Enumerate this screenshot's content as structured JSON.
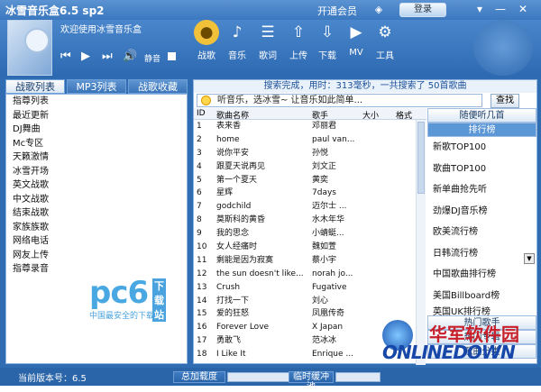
{
  "window": {
    "title": "冰雪音乐盒6.5 sp2",
    "vip": "开通会员",
    "login": "登录"
  },
  "player": {
    "now_playing": "欢迎使用冰雪音乐盒",
    "volume_label": "静音"
  },
  "toolbar": [
    {
      "label": "战歌",
      "icon": "disc-icon"
    },
    {
      "label": "音乐",
      "icon": "music-note-icon"
    },
    {
      "label": "歌词",
      "icon": "lyrics-icon"
    },
    {
      "label": "上传",
      "icon": "upload-icon"
    },
    {
      "label": "下载",
      "icon": "download-icon"
    },
    {
      "label": "MV",
      "icon": "play-triangle-icon"
    },
    {
      "label": "工具",
      "icon": "gear-icon"
    }
  ],
  "left_tabs": [
    "战歌列表",
    "MP3列表",
    "战歌收藏"
  ],
  "left_list": [
    "指尊列表",
    "最近更新",
    "DJ舞曲",
    "Mc专区",
    "天籁激情",
    "冰雪开场",
    "英文战歌",
    "中文战歌",
    "结束战歌",
    "家族族歌",
    "网络电话",
    "网友上传",
    "指尊录音"
  ],
  "watermark": {
    "brand": "pc6",
    "tag": "下载站",
    "sub": "中国最安全的下载站"
  },
  "results": {
    "status": "搜索完成，用时：313毫秒，一共搜索了 50首歌曲",
    "search_value": "听音乐，选冰雪~ 让音乐如此简单...",
    "find_button": "查找"
  },
  "table": {
    "headers": [
      "ID",
      "歌曲名称",
      "歌手",
      "大小",
      "格式"
    ],
    "rows": [
      [
        "1",
        "表来香",
        "邓丽君"
      ],
      [
        "2",
        "home",
        "paul van..."
      ],
      [
        "3",
        "说你平安",
        "孙悦"
      ],
      [
        "4",
        "跟夏天说再见",
        "刘文正"
      ],
      [
        "5",
        "第一个夏天",
        "黄奕"
      ],
      [
        "6",
        "星辉",
        "7days"
      ],
      [
        "7",
        "godchild",
        "迈尔士 ..."
      ],
      [
        "8",
        "莫斯科的黄昏",
        "水木年华"
      ],
      [
        "9",
        "我的思念",
        "小蜻蜓..."
      ],
      [
        "10",
        "女人经痛时",
        "魏如萱"
      ],
      [
        "11",
        "剩能是因为寂寞",
        "蔡小宇"
      ],
      [
        "12",
        "the sun doesn't like...",
        "norah jo..."
      ],
      [
        "13",
        "Crush",
        "Fugative"
      ],
      [
        "14",
        "打找一下",
        "刘心"
      ],
      [
        "15",
        "爱的狂怒",
        "凤凰传奇"
      ],
      [
        "16",
        "Forever Love",
        "X Japan"
      ],
      [
        "17",
        "勇敢飞",
        "范冰冰"
      ],
      [
        "18",
        "I Like It",
        "Enrique ..."
      ]
    ]
  },
  "right_panel": {
    "random": "随便听几首",
    "ranking_header": "排行榜",
    "ranks": [
      "新歌TOP100",
      "歌曲TOP100",
      "新单曲抢先听",
      "劲爆DJ音乐榜",
      "欧美流行榜",
      "日韩流行榜",
      "中国歌曲排行榜",
      "美国Billboard榜",
      "英国UK排行榜"
    ],
    "hot_singers": "热门歌手",
    "hot_albums": "热门专辑",
    "categories": "歌曲分类"
  },
  "footer": {
    "version": "当前版本号：6.5",
    "total_label": "总加载度",
    "buffer_label": "临时缓冲池"
  },
  "brand": {
    "cn": "华军软件园",
    "en": "ONLINEDOWN"
  }
}
